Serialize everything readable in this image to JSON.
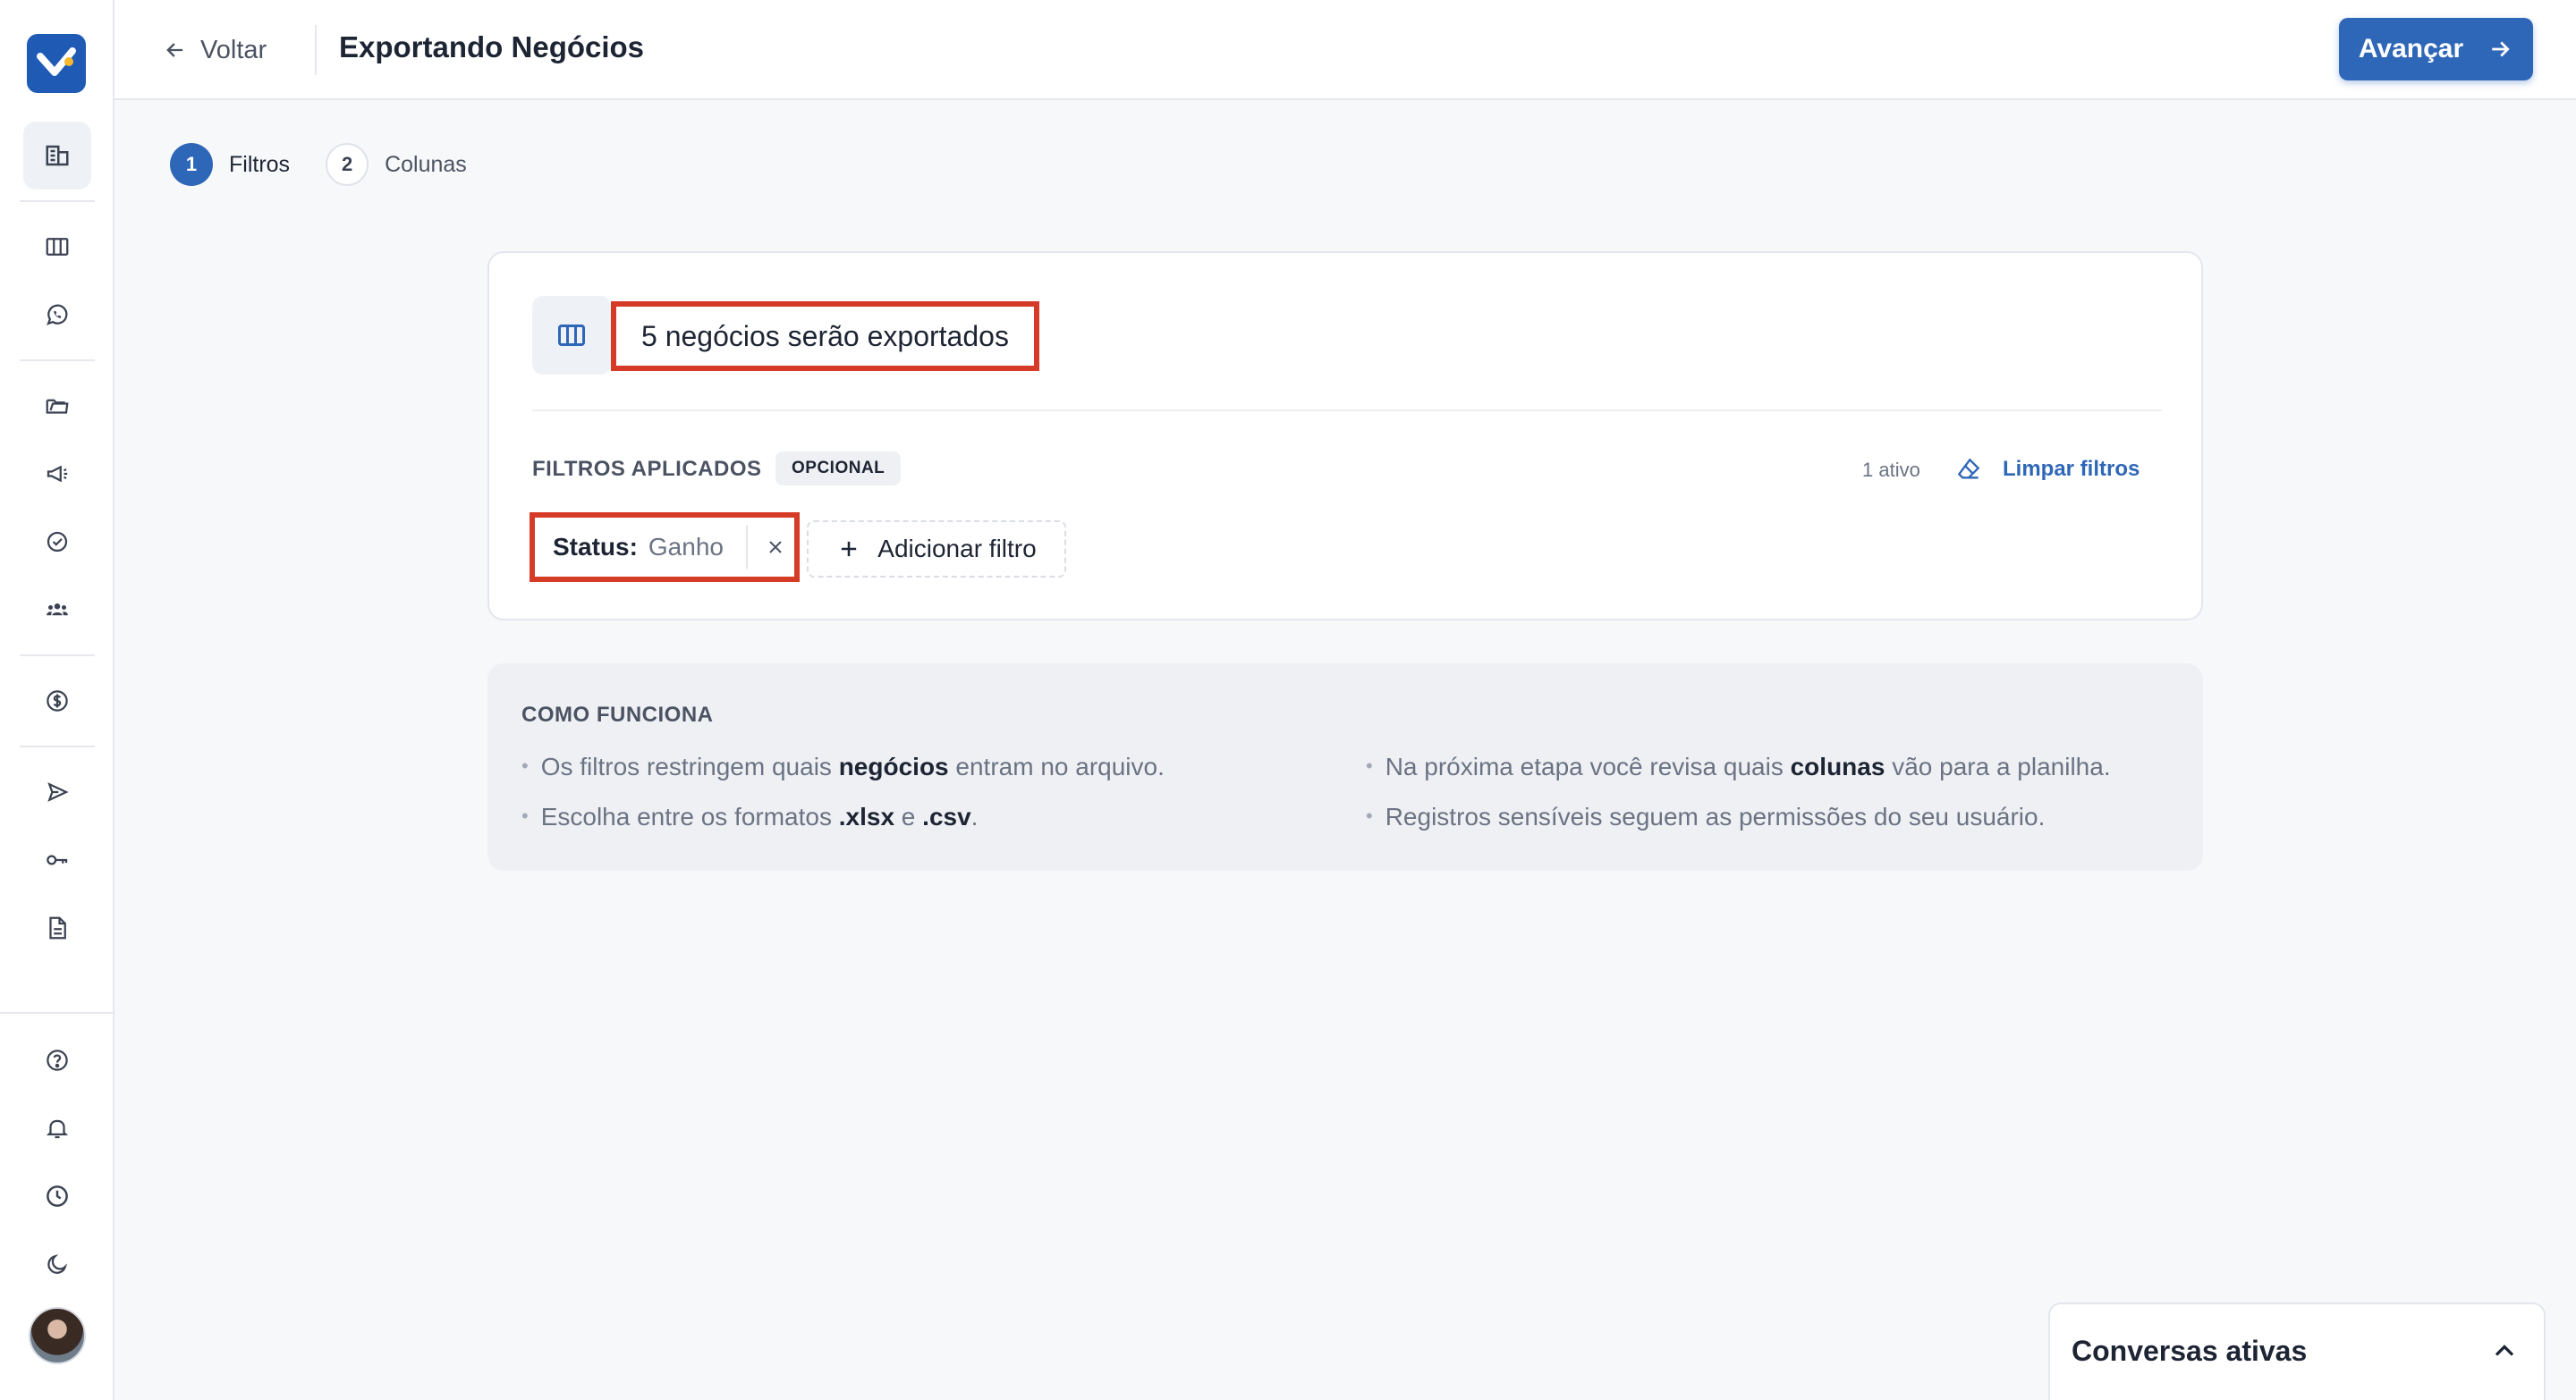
{
  "header": {
    "back_label": "Voltar",
    "title": "Exportando Negócios",
    "next_label": "Avançar"
  },
  "stepper": {
    "steps": [
      {
        "number": "1",
        "label": "Filtros",
        "active": true
      },
      {
        "number": "2",
        "label": "Colunas",
        "active": false
      }
    ]
  },
  "sidebar": {
    "items": [
      {
        "icon": "building-icon",
        "active": true
      },
      {
        "icon": "kanban-icon"
      },
      {
        "icon": "whatsapp-icon"
      },
      {
        "icon": "folder-icon"
      },
      {
        "icon": "megaphone-icon"
      },
      {
        "icon": "check-circle-icon"
      },
      {
        "icon": "users-icon"
      },
      {
        "icon": "dollar-icon"
      },
      {
        "icon": "send-icon"
      },
      {
        "icon": "key-icon"
      },
      {
        "icon": "document-icon"
      }
    ],
    "bottom_items": [
      {
        "icon": "help-icon"
      },
      {
        "icon": "bell-icon"
      },
      {
        "icon": "clock-icon"
      },
      {
        "icon": "moon-icon"
      }
    ]
  },
  "card": {
    "export_count_text": "5 negócios serão exportados",
    "filters_label": "FILTROS APLICADOS",
    "optional_badge": "OPCIONAL",
    "active_count": "1 ativo",
    "clear_label": "Limpar filtros",
    "filter_chip": {
      "key": "Status:",
      "value": "Ganho"
    },
    "add_filter_label": "Adicionar filtro"
  },
  "info": {
    "title": "COMO FUNCIONA",
    "items": [
      {
        "pre": "Os filtros restringem quais ",
        "bold": "negócios",
        "post": " entram no arquivo."
      },
      {
        "pre": "Escolha entre os formatos ",
        "bold": ".xlsx",
        "mid": " e ",
        "bold2": ".csv",
        "post": "."
      },
      {
        "pre": "Na próxima etapa você revisa quais ",
        "bold": "colunas",
        "post": " vão para a planilha."
      },
      {
        "pre": "Registros sensíveis seguem as permissões do seu usuário."
      }
    ]
  },
  "conversations": {
    "title": "Conversas ativas"
  },
  "colors": {
    "primary": "#2f67b8",
    "highlight": "#d63b27",
    "background": "#f7f8fa"
  }
}
